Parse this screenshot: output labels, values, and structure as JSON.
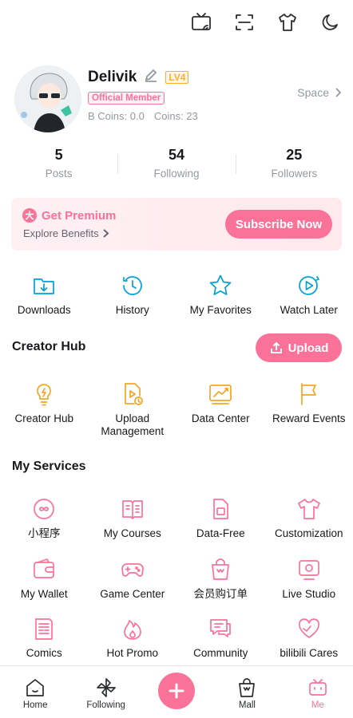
{
  "topbar": {
    "icons": [
      "cast-icon",
      "scan-icon",
      "theme-shirt-icon",
      "night-mode-icon"
    ]
  },
  "profile": {
    "username": "Delivik",
    "level": "LV4",
    "membership": "Official Member",
    "b_coins": "B Coins: 0.0",
    "coins": "Coins: 23",
    "space_label": "Space"
  },
  "stats": [
    {
      "value": "5",
      "label": "Posts"
    },
    {
      "value": "54",
      "label": "Following"
    },
    {
      "value": "25",
      "label": "Followers"
    }
  ],
  "premium": {
    "badge": "大",
    "title": "Get Premium",
    "subtitle": "Explore Benefits",
    "button": "Subscribe Now"
  },
  "quick": [
    {
      "label": "Downloads",
      "icon": "download-folder-icon"
    },
    {
      "label": "History",
      "icon": "history-clock-icon"
    },
    {
      "label": "My Favorites",
      "icon": "star-icon"
    },
    {
      "label": "Watch Later",
      "icon": "watch-later-icon"
    }
  ],
  "creator_hub": {
    "title": "Creator Hub",
    "upload_label": "Upload",
    "items": [
      {
        "label": "Creator Hub",
        "icon": "bulb-icon"
      },
      {
        "label": "Upload Management",
        "icon": "upload-management-icon"
      },
      {
        "label": "Data Center",
        "icon": "chart-icon"
      },
      {
        "label": "Reward Events",
        "icon": "flag-icon"
      }
    ]
  },
  "services": {
    "title": "My Services",
    "rows": [
      [
        {
          "label": "小程序",
          "icon": "mini-program-icon"
        },
        {
          "label": "My Courses",
          "icon": "courses-icon"
        },
        {
          "label": "Data-Free",
          "icon": "sim-card-icon"
        },
        {
          "label": "Customization",
          "icon": "shirt-icon"
        }
      ],
      [
        {
          "label": "My Wallet",
          "icon": "wallet-icon"
        },
        {
          "label": "Game Center",
          "icon": "gamepad-icon"
        },
        {
          "label": "会员购订单",
          "icon": "shopping-bag-icon"
        },
        {
          "label": "Live Studio",
          "icon": "live-tv-icon"
        }
      ],
      [
        {
          "label": "Comics",
          "icon": "comics-icon"
        },
        {
          "label": "Hot Promo",
          "icon": "flame-icon"
        },
        {
          "label": "Community",
          "icon": "chat-icon"
        },
        {
          "label": "bilibili Cares",
          "icon": "heart-icon"
        }
      ]
    ]
  },
  "tabbar": [
    {
      "label": "Home",
      "icon": "home-icon"
    },
    {
      "label": "Following",
      "icon": "pinwheel-icon"
    },
    {
      "label": "",
      "icon": "plus-icon"
    },
    {
      "label": "Mall",
      "icon": "mall-bag-icon"
    },
    {
      "label": "Me",
      "icon": "tv-face-icon",
      "active": true
    }
  ]
}
